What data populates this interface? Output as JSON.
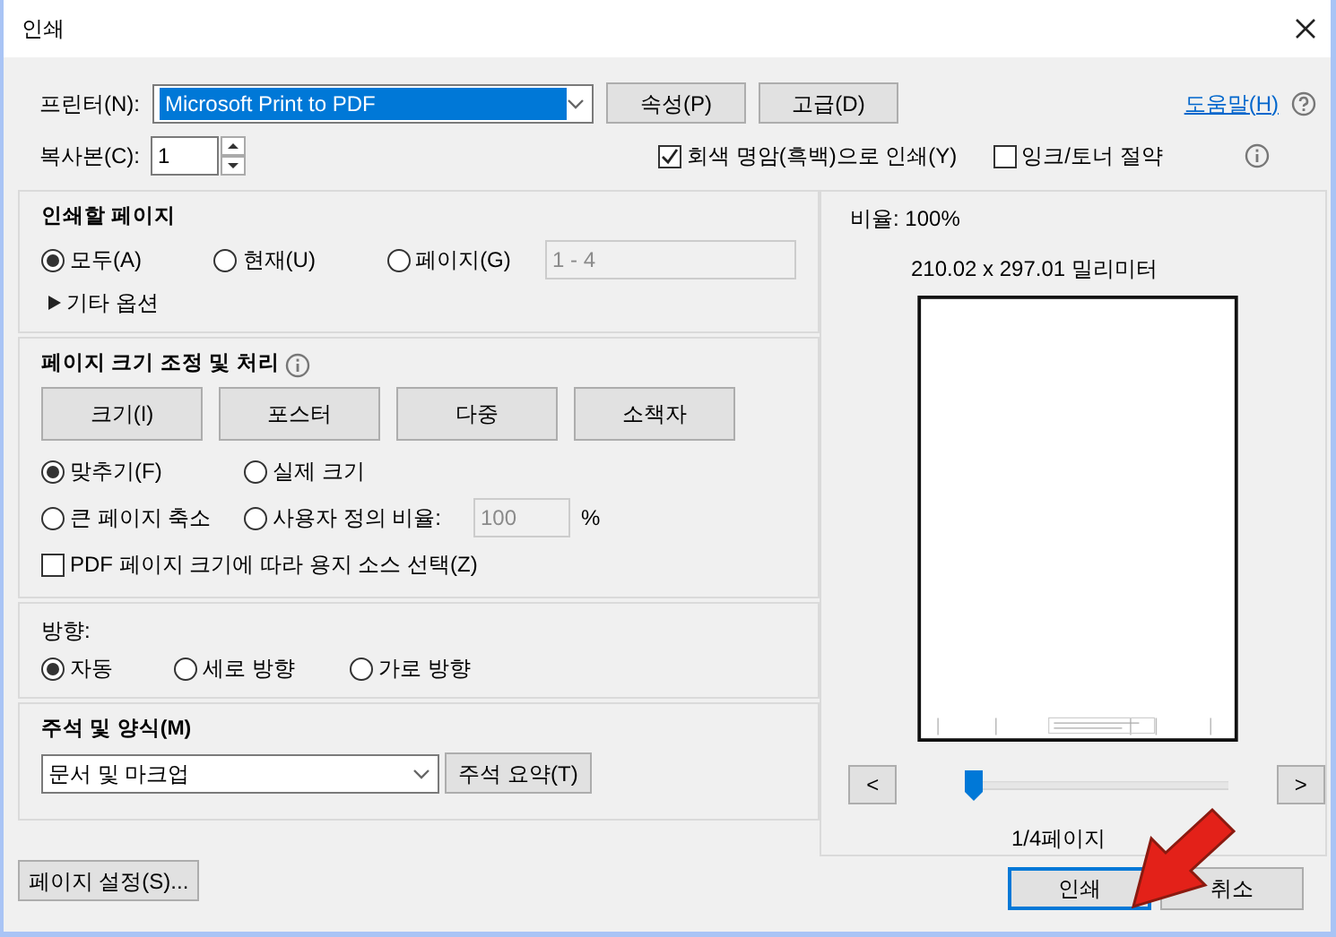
{
  "window": {
    "title": "인쇄"
  },
  "printer": {
    "label": "프린터(N):",
    "value": "Microsoft Print to PDF",
    "buttons": [
      "속성(P)",
      "고급(D)"
    ]
  },
  "help_link": "도움말(H)",
  "copies": {
    "label": "복사본(C):",
    "value": "1"
  },
  "options": [
    {
      "label": "회색 명암(흑백)으로 인쇄(Y)",
      "checked": true
    },
    {
      "label": "잉크/토너 절약",
      "checked": false
    }
  ],
  "pages_to_print": {
    "title": "인쇄할 페이지",
    "radios": [
      {
        "label": "모두(A)",
        "selected": true
      },
      {
        "label": "현재(U)",
        "selected": false
      },
      {
        "label": "페이지(G)",
        "selected": false
      }
    ],
    "range": {
      "value": "1 - 4",
      "disabled": true
    },
    "more_options": {
      "label": "기타 옵션",
      "expanded": false
    }
  },
  "page_sizing": {
    "title": "페이지 크기 조정 및 처리",
    "modes": [
      "크기(I)",
      "포스터",
      "다중",
      "소책자"
    ],
    "radios": [
      {
        "label": "맞추기(F)",
        "selected": true
      },
      {
        "label": "실제 크기",
        "selected": false
      },
      {
        "label": "큰 페이지 축소",
        "selected": false
      },
      {
        "label": "사용자 정의 비율:",
        "selected": false
      }
    ],
    "custom_scale": {
      "value": "100",
      "unit": "%",
      "disabled": true
    },
    "paper_source": {
      "label": "PDF 페이지 크기에 따라 용지 소스 선택(Z)",
      "checked": false
    }
  },
  "orientation": {
    "title": "방향:",
    "radios": [
      {
        "label": "자동",
        "selected": true
      },
      {
        "label": "세로 방향",
        "selected": false
      },
      {
        "label": "가로 방향",
        "selected": false
      }
    ]
  },
  "annotations": {
    "title": "주석 및 양식(M)",
    "value": "문서 및 마크업",
    "button": "주석 요약(T)"
  },
  "page_setup_button": "페이지 설정(S)...",
  "preview": {
    "scale": "비율: 100%",
    "size": "210.02 x 297.01 밀리미터",
    "prev": "<",
    "next": ">",
    "slider": {
      "level": 0
    },
    "page": "1/4페이지"
  },
  "buttons": [
    {
      "label": "인쇄",
      "default": true
    },
    {
      "label": "취소",
      "default": false
    }
  ]
}
